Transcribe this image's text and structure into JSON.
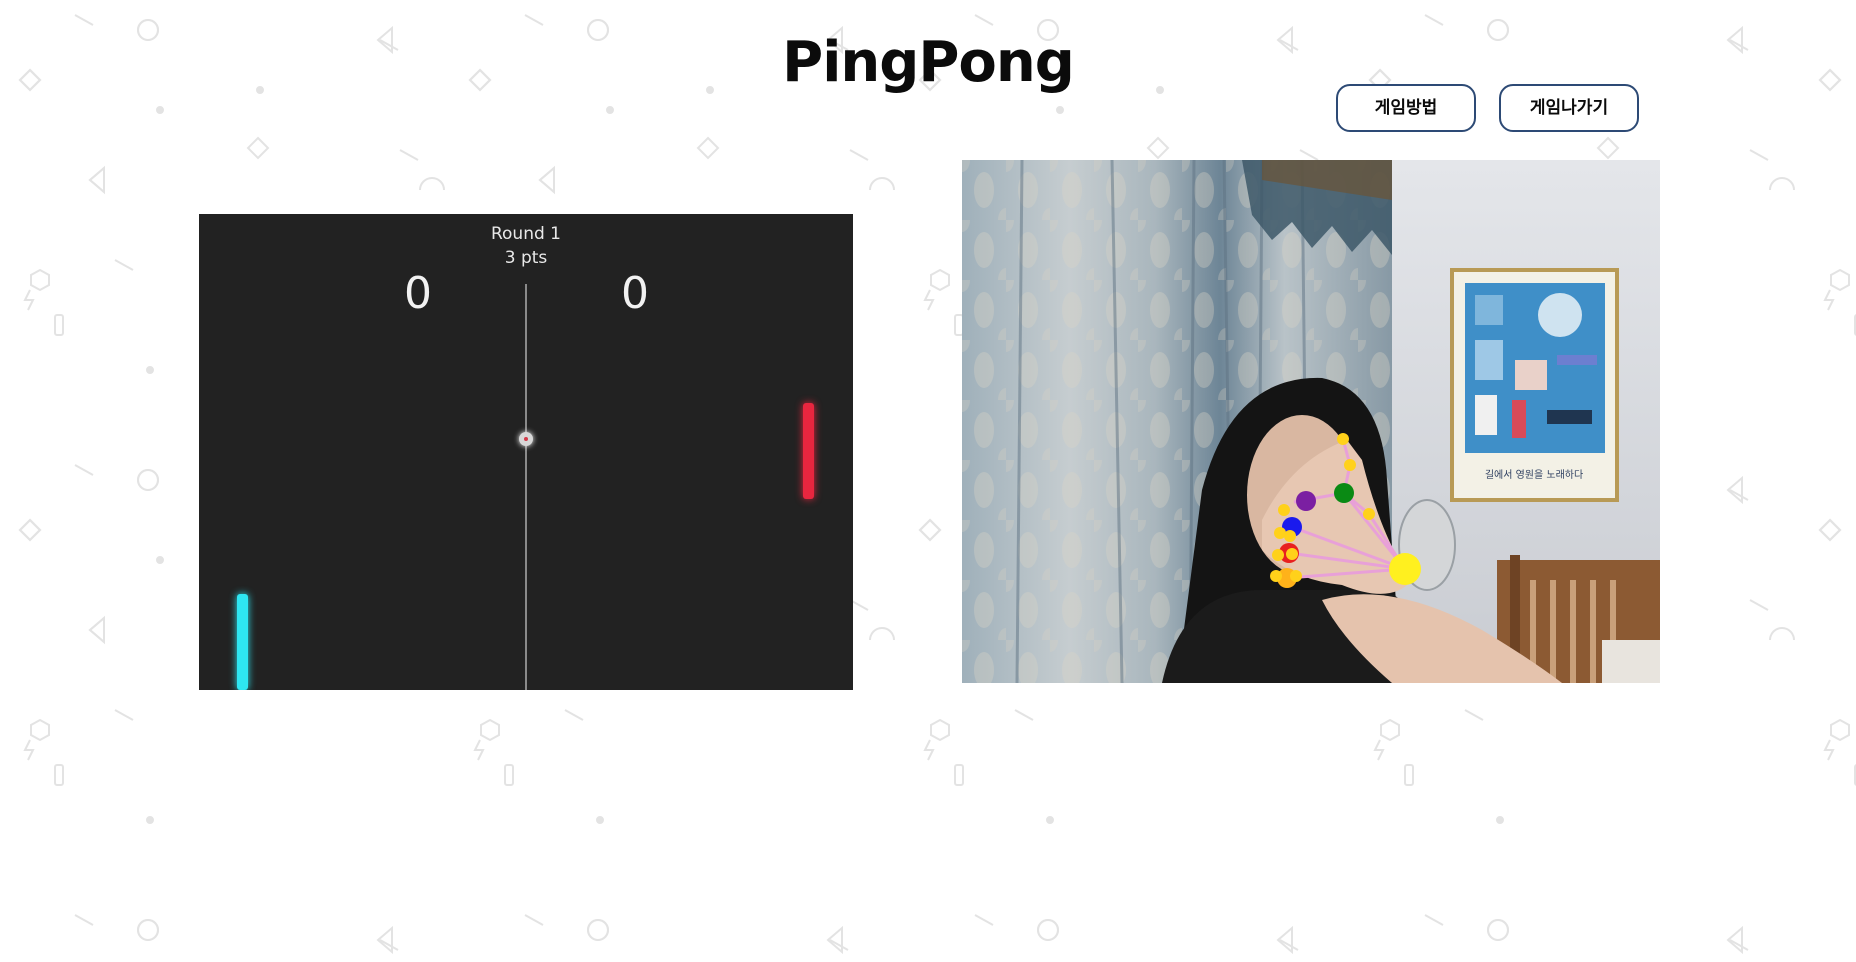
{
  "header": {
    "title": "PingPong",
    "how_to_play_label": "게임방법",
    "exit_game_label": "게임나가기"
  },
  "game": {
    "round_label": "Round 1",
    "points_label": "3 pts",
    "score_left": "0",
    "score_right": "0",
    "colors": {
      "board": "#222222",
      "left_paddle": "#2ee6f2",
      "right_paddle": "#e8263f"
    }
  },
  "webcam": {
    "poster_caption": "길에서 영원을 노래하다"
  },
  "colors": {
    "button_border": "#2d4a75",
    "title": "#0b0b0b"
  }
}
